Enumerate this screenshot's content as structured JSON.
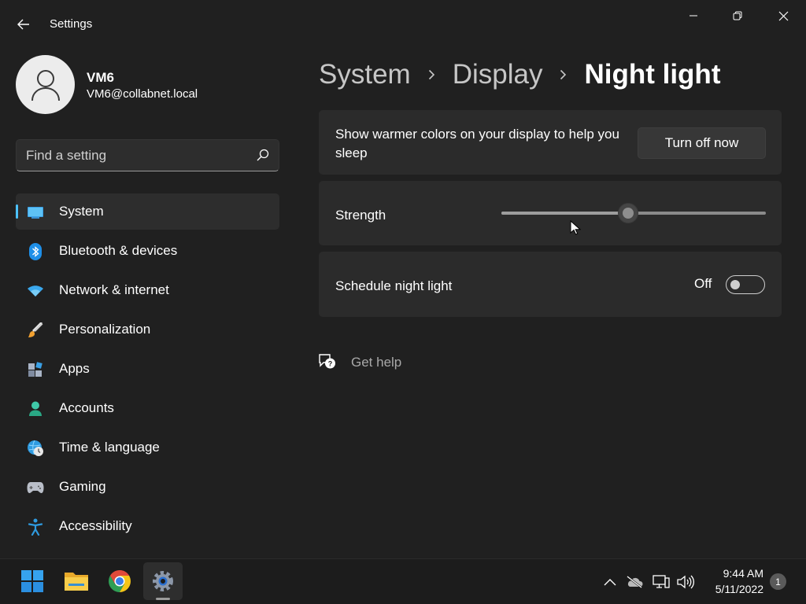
{
  "window": {
    "title": "Settings"
  },
  "profile": {
    "name": "VM6",
    "email": "VM6@collabnet.local"
  },
  "search": {
    "placeholder": "Find a setting"
  },
  "nav": {
    "items": [
      {
        "label": "System",
        "icon": "system-icon",
        "selected": true
      },
      {
        "label": "Bluetooth & devices",
        "icon": "bluetooth-icon"
      },
      {
        "label": "Network & internet",
        "icon": "wifi-icon"
      },
      {
        "label": "Personalization",
        "icon": "brush-icon"
      },
      {
        "label": "Apps",
        "icon": "apps-icon"
      },
      {
        "label": "Accounts",
        "icon": "accounts-icon"
      },
      {
        "label": "Time & language",
        "icon": "globe-clock-icon"
      },
      {
        "label": "Gaming",
        "icon": "gamepad-icon"
      },
      {
        "label": "Accessibility",
        "icon": "accessibility-icon"
      }
    ]
  },
  "breadcrumb": {
    "items": [
      "System",
      "Display",
      "Night light"
    ]
  },
  "night_light": {
    "description": "Show warmer colors on your display to help you sleep",
    "turn_off_label": "Turn off now",
    "strength_label": "Strength",
    "strength_value": 48,
    "schedule_label": "Schedule night light",
    "schedule_state": "Off"
  },
  "help": {
    "label": "Get help"
  },
  "taskbar": {
    "apps": [
      "start-icon",
      "file-explorer-icon",
      "chrome-icon",
      "settings-icon"
    ],
    "time": "9:44 AM",
    "date": "5/11/2022",
    "notification_count": "1"
  },
  "colors": {
    "background": "#202020",
    "card": "#2b2b2b",
    "accent": "#4cc2ff"
  }
}
